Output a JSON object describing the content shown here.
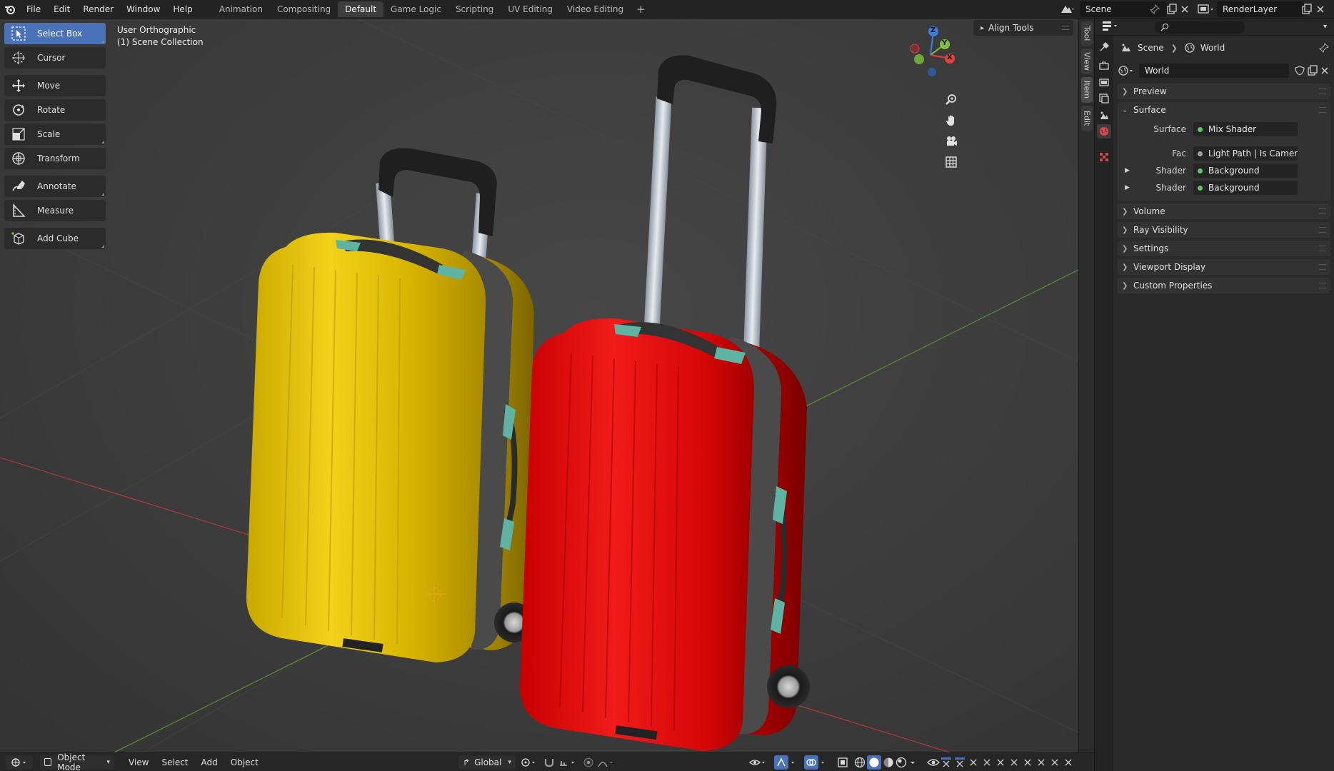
{
  "menu": {
    "file": "File",
    "edit": "Edit",
    "render": "Render",
    "window": "Window",
    "help": "Help"
  },
  "workspaces": [
    "Animation",
    "Compositing",
    "Default",
    "Game Logic",
    "Scripting",
    "UV Editing",
    "Video Editing"
  ],
  "workspace_add": "+",
  "scene_name": "Scene",
  "render_layer": "RenderLayer",
  "toolbar": {
    "select_box": "Select Box",
    "cursor": "Cursor",
    "move": "Move",
    "rotate": "Rotate",
    "scale": "Scale",
    "transform": "Transform",
    "annotate": "Annotate",
    "measure": "Measure",
    "add_cube": "Add Cube"
  },
  "viewport": {
    "view_name": "User Orthographic",
    "collection": "(1) Scene Collection",
    "align_tools": "Align Tools",
    "gizmo": {
      "y": "Y",
      "x": "X",
      "z": "Z"
    }
  },
  "side_tabs": {
    "tool": "Tool",
    "view": "View",
    "item": "Item",
    "edit": "Edit"
  },
  "header": {
    "mode": "Object Mode",
    "view": "View",
    "select": "Select",
    "add": "Add",
    "object": "Object",
    "orientation": "Global"
  },
  "properties": {
    "breadcrumb_scene": "Scene",
    "breadcrumb_world": "World",
    "world_name": "World",
    "panels": {
      "preview": "Preview",
      "surface": "Surface",
      "volume": "Volume",
      "ray_visibility": "Ray Visibility",
      "settings": "Settings",
      "viewport_display": "Viewport Display",
      "custom_properties": "Custom Properties"
    },
    "surface_rows": [
      {
        "label": "Surface",
        "value": "Mix Shader"
      },
      {
        "label": "Fac",
        "value": "Light Path | Is Camera Ray"
      },
      {
        "label": "Shader",
        "value": "Background"
      },
      {
        "label": "Shader",
        "value": "Background"
      }
    ]
  },
  "colors": {
    "accent": "#4a72b8",
    "suitcase_yellow": "#e3c100",
    "suitcase_red": "#e01010",
    "handle_teal": "#5fb3a3",
    "axis_x": "#e0423f",
    "axis_y": "#7ec23a",
    "axis_z": "#3a7ee0"
  }
}
